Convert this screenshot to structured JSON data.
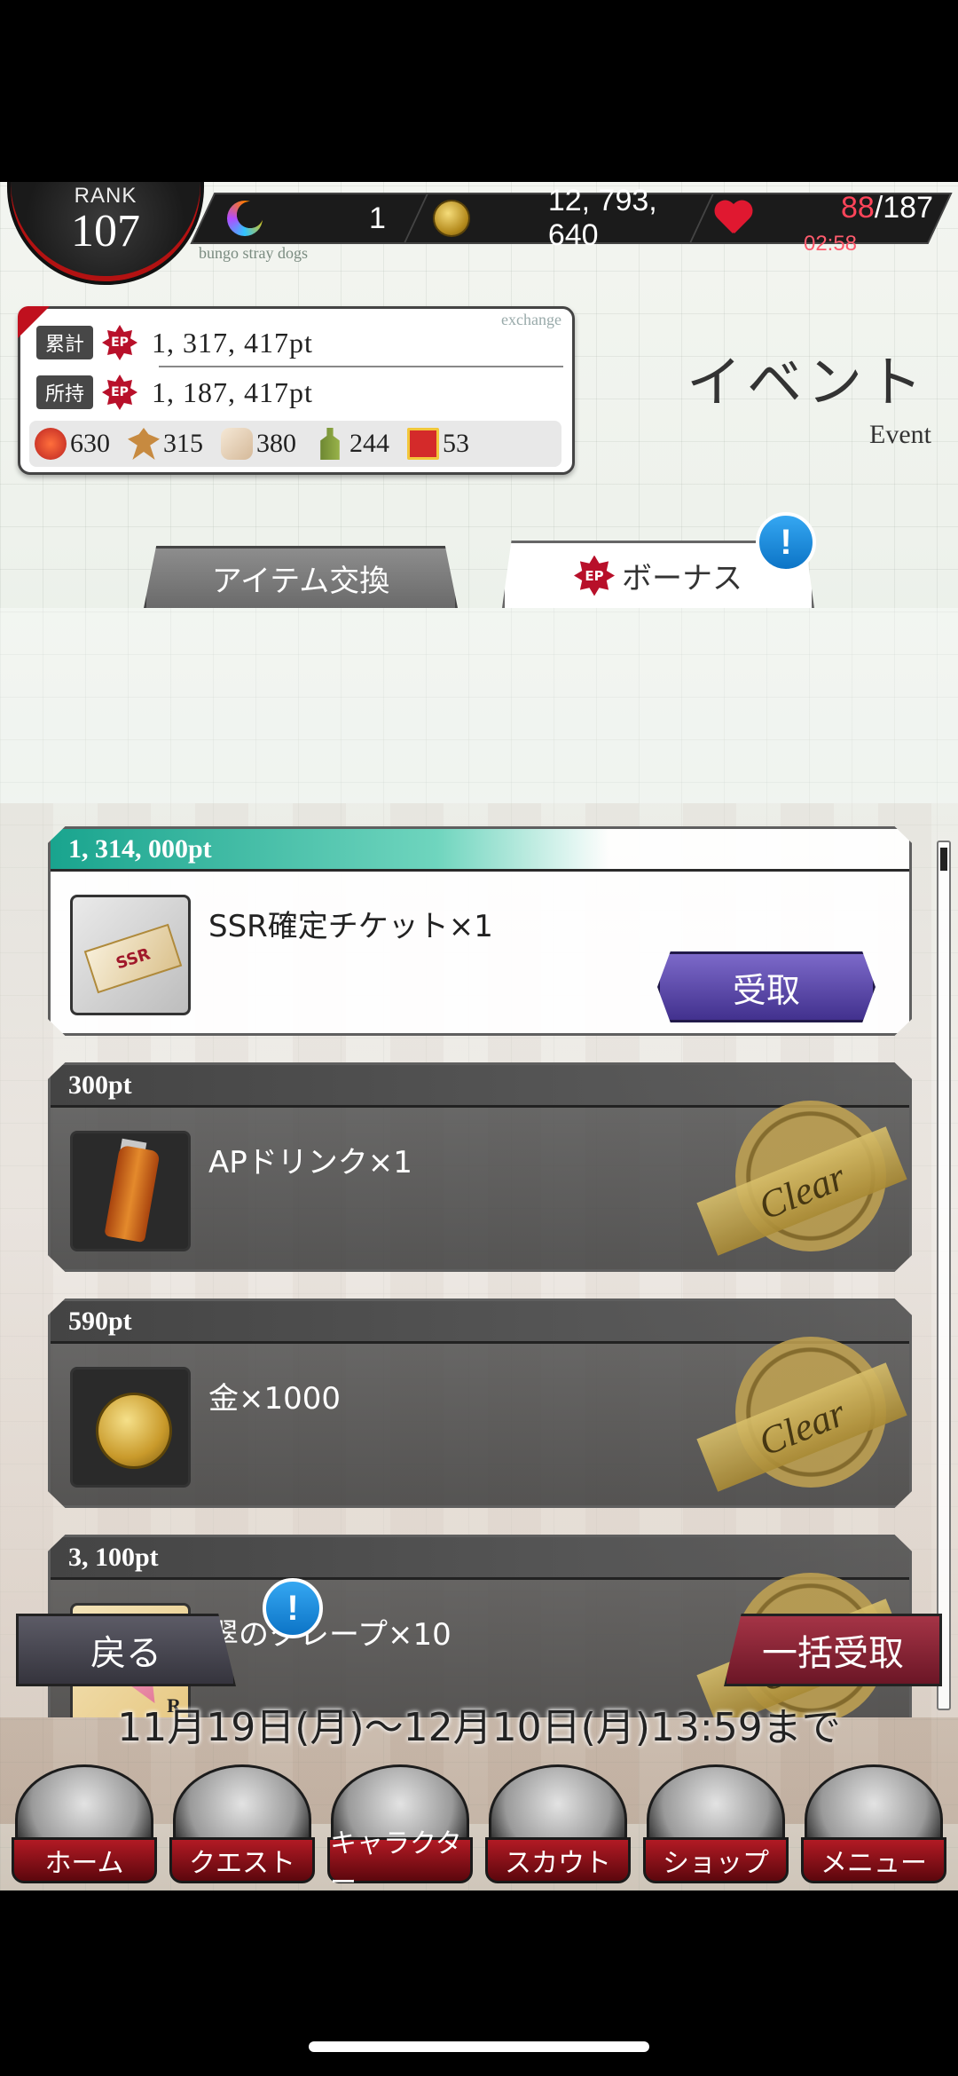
{
  "topbar": {
    "rank_label": "RANK",
    "rank_value": "107",
    "ap_value": "1",
    "gold_value": "12, 793, 640",
    "hp_current": "88",
    "hp_max": "/187",
    "hp_timer": "02:58",
    "caption": "bungo stray dogs"
  },
  "points": {
    "exchange_tag": "exchange",
    "total_label": "累計",
    "total_value": "1, 317, 417pt",
    "owned_label": "所持",
    "owned_value": "1, 187, 417pt",
    "ep_icon": "EP",
    "materials": [
      {
        "icon": "orange-candy-icon",
        "count": "630"
      },
      {
        "icon": "gingerbread-icon",
        "count": "315"
      },
      {
        "icon": "scroll-icon",
        "count": "380"
      },
      {
        "icon": "bottle-icon",
        "count": "244"
      },
      {
        "icon": "gift-box-icon",
        "count": "53"
      }
    ]
  },
  "page": {
    "title": "イベント",
    "subtitle": "Event"
  },
  "tabs": {
    "items_label": "アイテム交換",
    "bonus_label": "ボーナス",
    "alert": "!"
  },
  "rewards": [
    {
      "points": "1, 314, 000pt",
      "name": "SSR確定チケット×1",
      "status": "claimable",
      "button": "受取",
      "ticket_text": "SSR"
    },
    {
      "points": "300pt",
      "name": "APドリンク×1",
      "status": "cleared",
      "stamp": "Clear"
    },
    {
      "points": "590pt",
      "name": "金×1000",
      "status": "cleared",
      "stamp": "Clear"
    },
    {
      "points": "3, 100pt",
      "name": "翠のクレープ×10",
      "status": "cleared",
      "stamp": "Clear",
      "rarity": "R"
    }
  ],
  "controls": {
    "back_label": "戻る",
    "claim_all_label": "一括受取",
    "period": "11月19日(月)〜12月10日(月)13:59まで"
  },
  "nav": {
    "items": [
      {
        "label": "ホーム",
        "icon": "home-icon"
      },
      {
        "label": "クエスト",
        "icon": "quest-icon"
      },
      {
        "label": "キャラクター",
        "icon": "character-icon"
      },
      {
        "label": "スカウト",
        "icon": "scout-icon"
      },
      {
        "label": "ショップ",
        "icon": "shop-icon"
      },
      {
        "label": "メニュー",
        "icon": "menu-icon"
      }
    ],
    "alert": "!"
  },
  "colors": {
    "accent_teal": "#19a48e",
    "claim_purple": "#42318e",
    "nav_red": "#b21a24",
    "hp_red": "#ff4459"
  }
}
